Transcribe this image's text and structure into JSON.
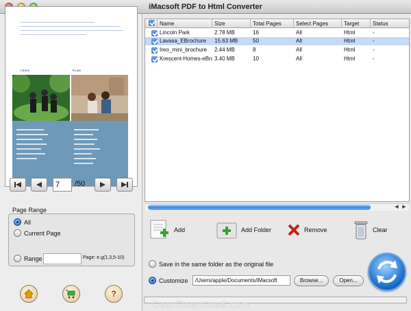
{
  "window": {
    "title": "iMacsoft PDF to Html Converter"
  },
  "preview": {
    "page_number": "7",
    "page_total": "/50",
    "thumb_heading_left": "LEXIS",
    "thumb_heading_right": "PLAN"
  },
  "page_range": {
    "title": "Page Range",
    "options": {
      "all": "All",
      "current": "Current Page",
      "range": "Range"
    },
    "selected": "All",
    "range_hint": "Page: e.g(1,3,5-10)"
  },
  "table": {
    "headers": [
      "Name",
      "Size",
      "Total Pages",
      "Select Pages",
      "Target",
      "Status"
    ],
    "rows": [
      {
        "name": "Lincoln Park",
        "size": "2.78 MB",
        "total_pages": "16",
        "select_pages": "All",
        "target": "Html",
        "status": "-"
      },
      {
        "name": "Lavasa_EBrochure",
        "size": "15.63 MB",
        "total_pages": "50",
        "select_pages": "All",
        "target": "Html",
        "status": "-"
      },
      {
        "name": "Ireo_mini_brochure",
        "size": "2.44 MB",
        "total_pages": "8",
        "select_pages": "All",
        "target": "Html",
        "status": "-"
      },
      {
        "name": "Krescent-Homes-eBrochure",
        "size": "3.40 MB",
        "total_pages": "10",
        "select_pages": "All",
        "target": "Html",
        "status": "-"
      }
    ]
  },
  "actions": {
    "add": "Add",
    "add_folder": "Add Folder",
    "remove": "Remove",
    "clear": "Clear"
  },
  "output": {
    "same_folder_label": "Save in the same folder as the original file",
    "customize_label": "Customize",
    "path": "/Users/apple/Documents/iMacsoft",
    "browse": "Browse...",
    "open": "Open..."
  },
  "watermark": "GearDownload.com"
}
